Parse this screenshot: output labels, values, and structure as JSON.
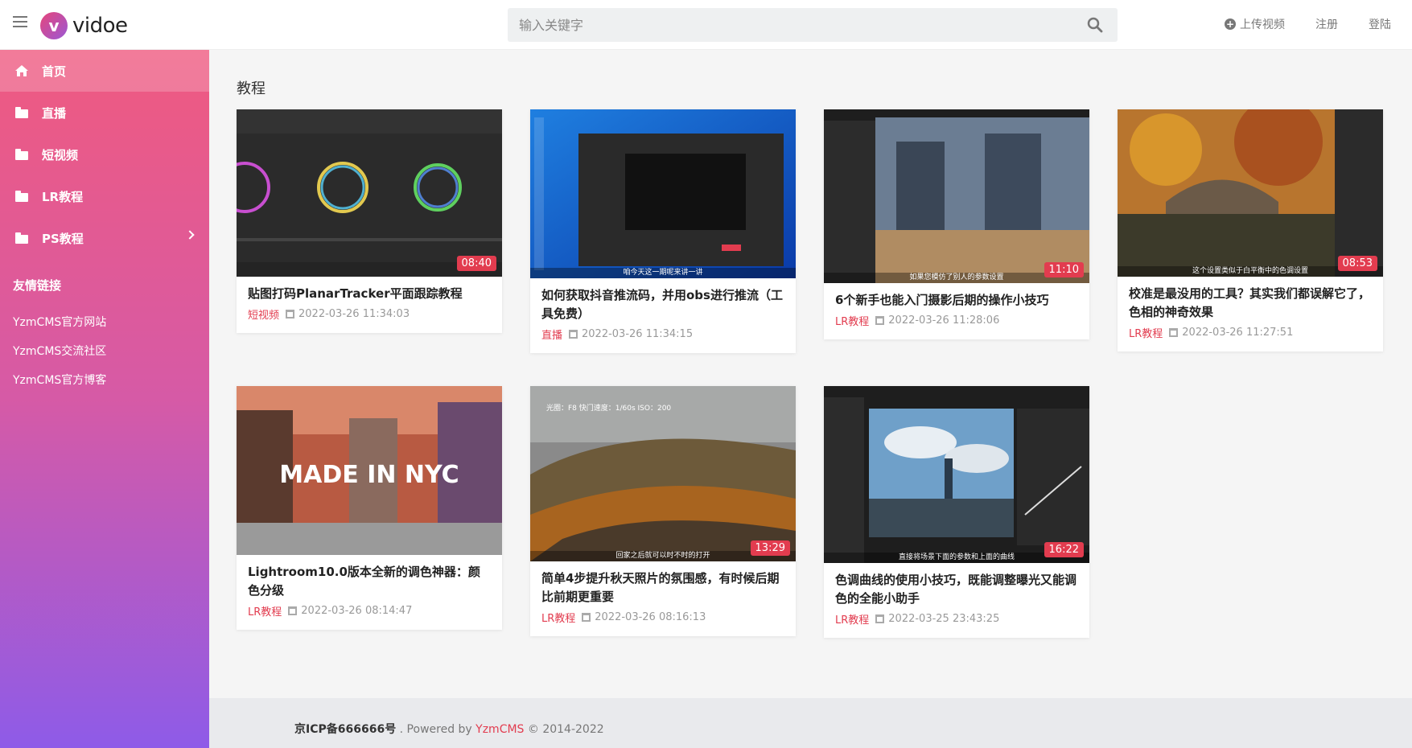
{
  "header": {
    "logo_mark": "v",
    "logo_text": "vidoe",
    "search_placeholder": "输入关键字",
    "upload_label": "上传视频",
    "register_label": "注册",
    "login_label": "登陆"
  },
  "sidebar": {
    "items": [
      {
        "label": "首页",
        "icon": "home-icon",
        "active": true
      },
      {
        "label": "直播",
        "icon": "folder-icon"
      },
      {
        "label": "短视频",
        "icon": "folder-icon"
      },
      {
        "label": "LR教程",
        "icon": "folder-icon"
      },
      {
        "label": "PS教程",
        "icon": "folder-icon",
        "has_submenu": true
      }
    ],
    "links_title": "友情链接",
    "links": [
      "YzmCMS官方网站",
      "YzmCMS交流社区",
      "YzmCMS官方博客"
    ]
  },
  "main": {
    "section_title": "教程",
    "videos": [
      {
        "title": "贴图打码PlanarTracker平面跟踪教程",
        "category": "短视频",
        "date": "2022-03-26 11:34:03",
        "duration": "08:40",
        "caption": ""
      },
      {
        "title": "如何获取抖音推流码，并用obs进行推流（工具免费）",
        "category": "直播",
        "date": "2022-03-26 11:34:15",
        "duration": "",
        "caption": "咱今天这一期呢来讲一讲"
      },
      {
        "title": "6个新手也能入门摄影后期的操作小技巧",
        "category": "LR教程",
        "date": "2022-03-26 11:28:06",
        "duration": "11:10",
        "caption": "如果您模仿了别人的参数设置"
      },
      {
        "title": "校准是最没用的工具？其实我们都误解它了，色相的神奇效果",
        "category": "LR教程",
        "date": "2022-03-26 11:27:51",
        "duration": "08:53",
        "caption": "这个设置类似于白平衡中的色调设置"
      },
      {
        "title": "Lightroom10.0版本全新的调色神器：颜色分级",
        "category": "LR教程",
        "date": "2022-03-26 08:14:47",
        "duration": "",
        "caption": "",
        "overlay": "MADE IN NYC"
      },
      {
        "title": "简单4步提升秋天照片的氛围感，有时候后期比前期更重要",
        "category": "LR教程",
        "date": "2022-03-26 08:16:13",
        "duration": "13:29",
        "caption": "回家之后就可以时不时的打开",
        "overlay": "光圈：F8  快门速度：1/60s  ISO：200"
      },
      {
        "title": "色调曲线的使用小技巧，既能调整曝光又能调色的全能小助手",
        "category": "LR教程",
        "date": "2022-03-25 23:43:25",
        "duration": "16:22",
        "caption": "直接将场景下面的参数和上面的曲线"
      }
    ]
  },
  "footer": {
    "icp": "京ICP备666666号",
    "powered": " . Powered by ",
    "brand": "YzmCMS",
    "copyright": " © 2014-2022"
  }
}
